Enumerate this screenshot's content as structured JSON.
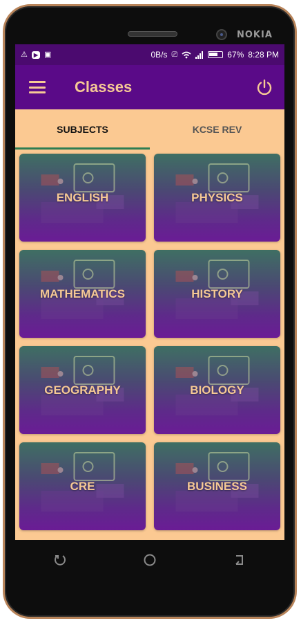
{
  "device": {
    "brand": "NOKIA"
  },
  "statusbar": {
    "speed": "0B/s",
    "battery": "67%",
    "time": "8:28 PM",
    "icons": [
      "alert-icon",
      "youtube-icon",
      "image-icon",
      "cast-icon",
      "wifi-icon",
      "signal-icon",
      "battery-icon"
    ]
  },
  "appbar": {
    "title": "Classes",
    "menu_icon": "menu-icon",
    "power_icon": "power-icon"
  },
  "tabs": [
    {
      "label": "SUBJECTS",
      "active": true
    },
    {
      "label": "KCSE REV",
      "active": false
    }
  ],
  "subjects": [
    {
      "label": "ENGLISH"
    },
    {
      "label": "PHYSICS"
    },
    {
      "label": "MATHEMATICS"
    },
    {
      "label": "HISTORY"
    },
    {
      "label": "GEOGRAPHY"
    },
    {
      "label": "BIOLOGY"
    },
    {
      "label": "CRE"
    },
    {
      "label": "BUSINESS"
    }
  ],
  "navbar": {
    "buttons": [
      "recents-icon",
      "home-icon",
      "back-icon"
    ]
  },
  "colors": {
    "primary": "#5a0a88",
    "status": "#4b0a6f",
    "accent": "#f6c995",
    "background": "#fbc992",
    "indicator": "#2e7d52"
  }
}
